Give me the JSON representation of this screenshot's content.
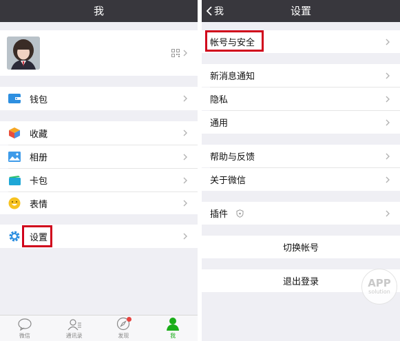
{
  "left": {
    "title": "我",
    "menu": {
      "wallet": "钱包",
      "favorites": "收藏",
      "album": "相册",
      "cards": "卡包",
      "stickers": "表情",
      "settings": "设置"
    },
    "tabs": [
      {
        "label": "微信",
        "icon": "chat-icon"
      },
      {
        "label": "通讯录",
        "icon": "contacts-icon"
      },
      {
        "label": "发现",
        "icon": "compass-icon"
      },
      {
        "label": "我",
        "icon": "person-icon"
      }
    ]
  },
  "right": {
    "back_label": "我",
    "title": "设置",
    "items": {
      "account_security": "帐号与安全",
      "notifications": "新消息通知",
      "privacy": "隐私",
      "general": "通用",
      "help_feedback": "帮助与反馈",
      "about": "关于微信",
      "plugins": "插件",
      "switch_account": "切换帐号",
      "logout": "退出登录"
    }
  },
  "watermark": {
    "line1": "APP",
    "line2": "solution"
  },
  "colors": {
    "navbar": "#38373d",
    "background": "#efeff4",
    "highlight_box": "#d0021b",
    "active_tab": "#1aad19",
    "badge": "#e64340"
  }
}
